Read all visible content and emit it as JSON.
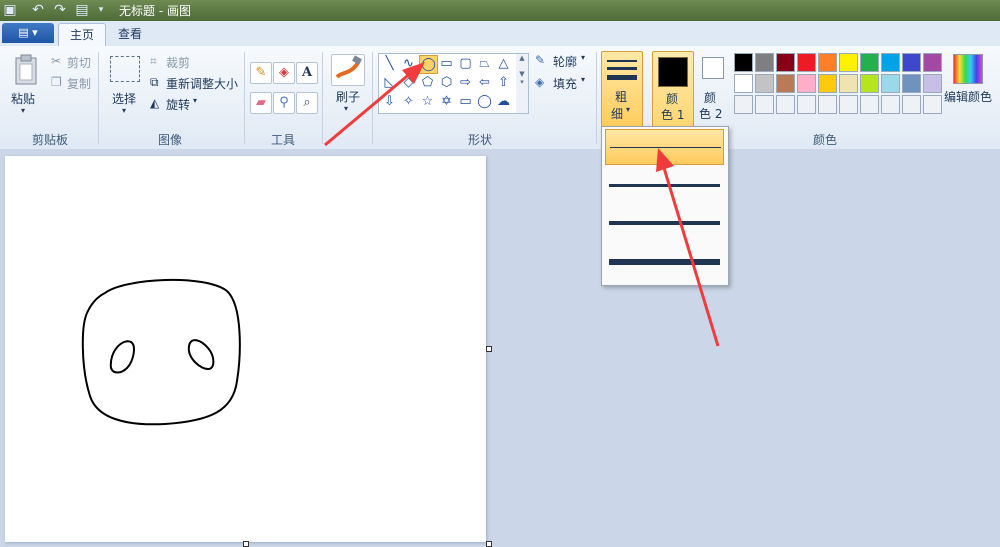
{
  "window": {
    "title": "无标题 - 画图"
  },
  "tabs": [
    {
      "label": "主页"
    },
    {
      "label": "查看"
    }
  ],
  "clipboard": {
    "paste": "粘贴",
    "cut": "剪切",
    "copy": "复制",
    "group": "剪贴板"
  },
  "image": {
    "select": "选择",
    "crop": "裁剪",
    "resize": "重新调整大小",
    "rotate": "旋转",
    "group": "图像"
  },
  "tools": {
    "group": "工具",
    "text_glyph": "A"
  },
  "brush": {
    "label": "刷子"
  },
  "shapes": {
    "outline": "轮廓",
    "fill": "填充",
    "group": "形状"
  },
  "size": {
    "label_line1": "粗",
    "label_line2": "细"
  },
  "colors": {
    "color1_line1": "颜",
    "color1_line2": "色 1",
    "color2_line1": "颜",
    "color2_line2": "色 2",
    "edit": "编辑颜色",
    "group": "颜色",
    "color1_value": "#000000",
    "color2_value": "#ffffff",
    "palette_row1": [
      "#000000",
      "#7f7f7f",
      "#880015",
      "#ed1c24",
      "#ff7f27",
      "#fff200",
      "#22b14c",
      "#00a2e8",
      "#3f48cc",
      "#a349a4"
    ],
    "palette_row2": [
      "#ffffff",
      "#c3c3c3",
      "#b97a57",
      "#ffaec9",
      "#ffc90e",
      "#efe4b0",
      "#b5e61d",
      "#99d9ea",
      "#7092be",
      "#c8bfe7"
    ]
  },
  "size_options": [
    1,
    3,
    5,
    8
  ],
  "accent": {
    "highlight": "#ffcd5e",
    "arrow": "#f03c3c"
  }
}
